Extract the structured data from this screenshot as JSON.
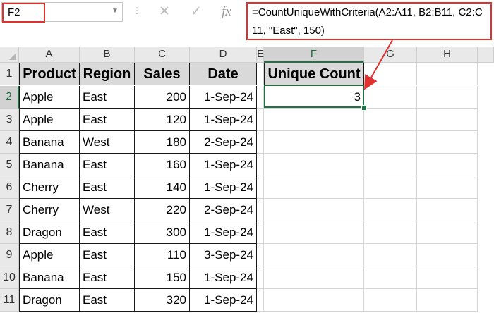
{
  "formula_bar": {
    "name_box": "F2",
    "name_box_dropdown_icon": "triangle-down",
    "cancel_icon": "✕",
    "enter_icon": "✓",
    "fx_label": "fx",
    "formula": "=CountUniqueWithCriteria(A2:A11, B2:B11, C2:C11, \"East\", 150)"
  },
  "columns": [
    "A",
    "B",
    "C",
    "D",
    "E",
    "F",
    "G",
    "H"
  ],
  "rows": [
    "1",
    "2",
    "3",
    "4",
    "5",
    "6",
    "7",
    "8",
    "9",
    "10",
    "11"
  ],
  "table": {
    "headers": [
      "Product",
      "Region",
      "Sales",
      "Date"
    ],
    "data": [
      [
        "Apple",
        "East",
        "200",
        "1-Sep-24"
      ],
      [
        "Apple",
        "East",
        "120",
        "1-Sep-24"
      ],
      [
        "Banana",
        "West",
        "180",
        "2-Sep-24"
      ],
      [
        "Banana",
        "East",
        "160",
        "1-Sep-24"
      ],
      [
        "Cherry",
        "East",
        "140",
        "1-Sep-24"
      ],
      [
        "Cherry",
        "West",
        "220",
        "2-Sep-24"
      ],
      [
        "Dragon",
        "East",
        "300",
        "1-Sep-24"
      ],
      [
        "Apple",
        "East",
        "110",
        "3-Sep-24"
      ],
      [
        "Banana",
        "East",
        "150",
        "1-Sep-24"
      ],
      [
        "Dragon",
        "East",
        "320",
        "1-Sep-24"
      ]
    ]
  },
  "result": {
    "header": "Unique Count",
    "value": "3"
  },
  "colors": {
    "accent": "#217346",
    "highlight": "#e03030",
    "header_fill": "#d9d9d9"
  }
}
